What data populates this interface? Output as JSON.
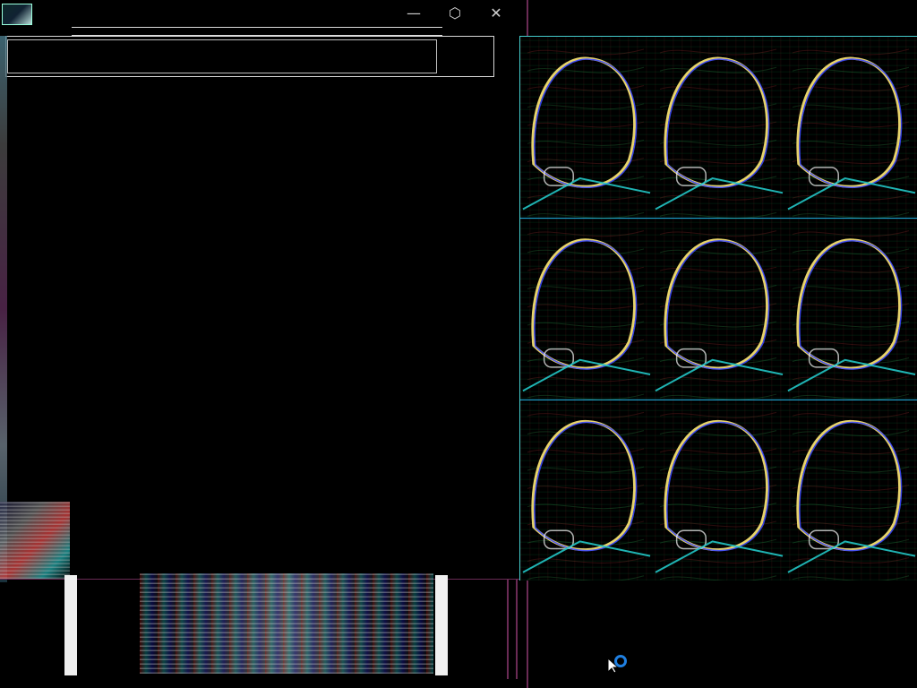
{
  "window": {
    "controls": {
      "minimize_glyph": "—",
      "restore_glyph": "⬡",
      "close_glyph": "✕"
    },
    "address_bar": {
      "value": "",
      "placeholder": ""
    }
  },
  "viewer": {
    "pattern": {
      "columns": 3,
      "rows": 3
    }
  },
  "icons": {
    "app": "app-icon",
    "minimize": "minimize-icon",
    "restore": "restore-icon",
    "close": "close-icon",
    "cursor": "pointer-cursor-icon",
    "busy": "busy-spinner-icon"
  },
  "colors": {
    "frame": "#6a2b55",
    "viewer_edge": "#44cccc",
    "busy": "#1f7fe0"
  }
}
